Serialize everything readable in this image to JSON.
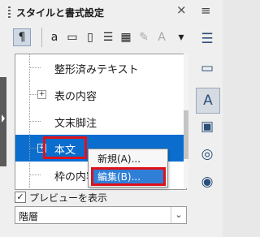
{
  "panel": {
    "title": "スタイルと書式設定",
    "close_glyph": "×",
    "menu_glyph": "≡"
  },
  "toolbar": [
    {
      "icon": "paragraph-styles-icon",
      "glyph": "¶",
      "active": true,
      "disabled": false
    },
    {
      "icon": "character-styles-icon",
      "glyph": "a",
      "active": false,
      "disabled": false
    },
    {
      "icon": "frame-styles-icon",
      "glyph": "▭",
      "active": false,
      "disabled": false
    },
    {
      "icon": "page-styles-icon",
      "glyph": "▯",
      "active": false,
      "disabled": false
    },
    {
      "icon": "list-styles-icon",
      "glyph": "☰",
      "active": false,
      "disabled": false
    },
    {
      "icon": "table-styles-icon",
      "glyph": "▦",
      "active": false,
      "disabled": false
    },
    {
      "icon": "fill-format-mode-icon",
      "glyph": "✎",
      "active": false,
      "disabled": true
    },
    {
      "icon": "styles-actions-icon",
      "glyph": "A",
      "active": false,
      "disabled": true
    },
    {
      "icon": "dropdown-arrow-icon",
      "glyph": "▾",
      "active": false,
      "disabled": false
    }
  ],
  "tree": [
    {
      "label": "整形済みテキスト",
      "expander": false,
      "selected": false,
      "highlighted": false
    },
    {
      "label": "表の内容",
      "expander": true,
      "selected": false,
      "highlighted": false
    },
    {
      "label": "文末脚注",
      "expander": false,
      "selected": false,
      "highlighted": false
    },
    {
      "label": "本文",
      "expander": true,
      "selected": true,
      "highlighted": true
    },
    {
      "label": "枠の内容",
      "expander": false,
      "selected": false,
      "highlighted": false
    }
  ],
  "context_menu": [
    {
      "label": "新規(A)...",
      "hover": false
    },
    {
      "label": "編集(B)...",
      "hover": true
    }
  ],
  "preview": {
    "label": "プレビューを表示",
    "checked": true,
    "check_glyph": "✓"
  },
  "filter": {
    "value": "階層",
    "arrow": "⌄"
  },
  "right_sidebar": [
    {
      "icon": "properties-icon",
      "glyph": "☰",
      "active": false
    },
    {
      "icon": "page-icon",
      "glyph": "▭",
      "active": false
    },
    {
      "icon": "styles-icon",
      "glyph": "A",
      "active": true
    },
    {
      "icon": "gallery-icon",
      "glyph": "▣",
      "active": false
    },
    {
      "icon": "navigator-icon",
      "glyph": "◎",
      "active": false
    },
    {
      "icon": "style-inspector-icon",
      "glyph": "◉",
      "active": false
    }
  ],
  "colors": {
    "selection": "#0b6ecf",
    "highlight_border": "#e0101a",
    "menu_hover": "#2f7fd6"
  }
}
